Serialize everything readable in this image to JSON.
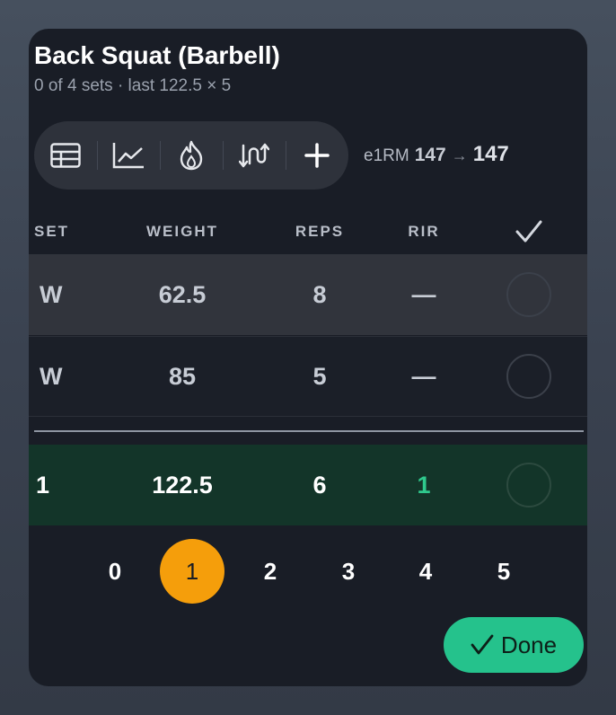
{
  "exercise": {
    "title": "Back Squat (Barbell)",
    "subtitle": "0 of 4 sets · last 122.5 × 5"
  },
  "toolbar": {
    "items": [
      {
        "icon": "table-icon"
      },
      {
        "icon": "chart-icon"
      },
      {
        "icon": "flame-icon"
      },
      {
        "icon": "swap-icon"
      },
      {
        "icon": "plus-icon"
      }
    ]
  },
  "e1rm": {
    "label": "e1RM",
    "from": "147",
    "arrow": "→",
    "to": "147"
  },
  "table": {
    "headers": {
      "set": "SET",
      "weight": "WEIGHT",
      "reps": "REPS",
      "rir": "RIR",
      "check": "✓"
    },
    "rows": [
      {
        "set": "W",
        "weight": "62.5",
        "reps": "8",
        "rir": "—"
      },
      {
        "set": "W",
        "weight": "85",
        "reps": "5",
        "rir": "—"
      },
      {
        "set": "1",
        "weight": "122.5",
        "reps": "6",
        "rir": "1"
      }
    ]
  },
  "rir_picker": {
    "options": [
      "0",
      "1",
      "2",
      "3",
      "4",
      "5"
    ],
    "selected": "1"
  },
  "done_button": {
    "label": "Done"
  },
  "colors": {
    "accent_orange": "#f59e0b",
    "accent_green": "#25c28c",
    "active_row": "#133529"
  }
}
